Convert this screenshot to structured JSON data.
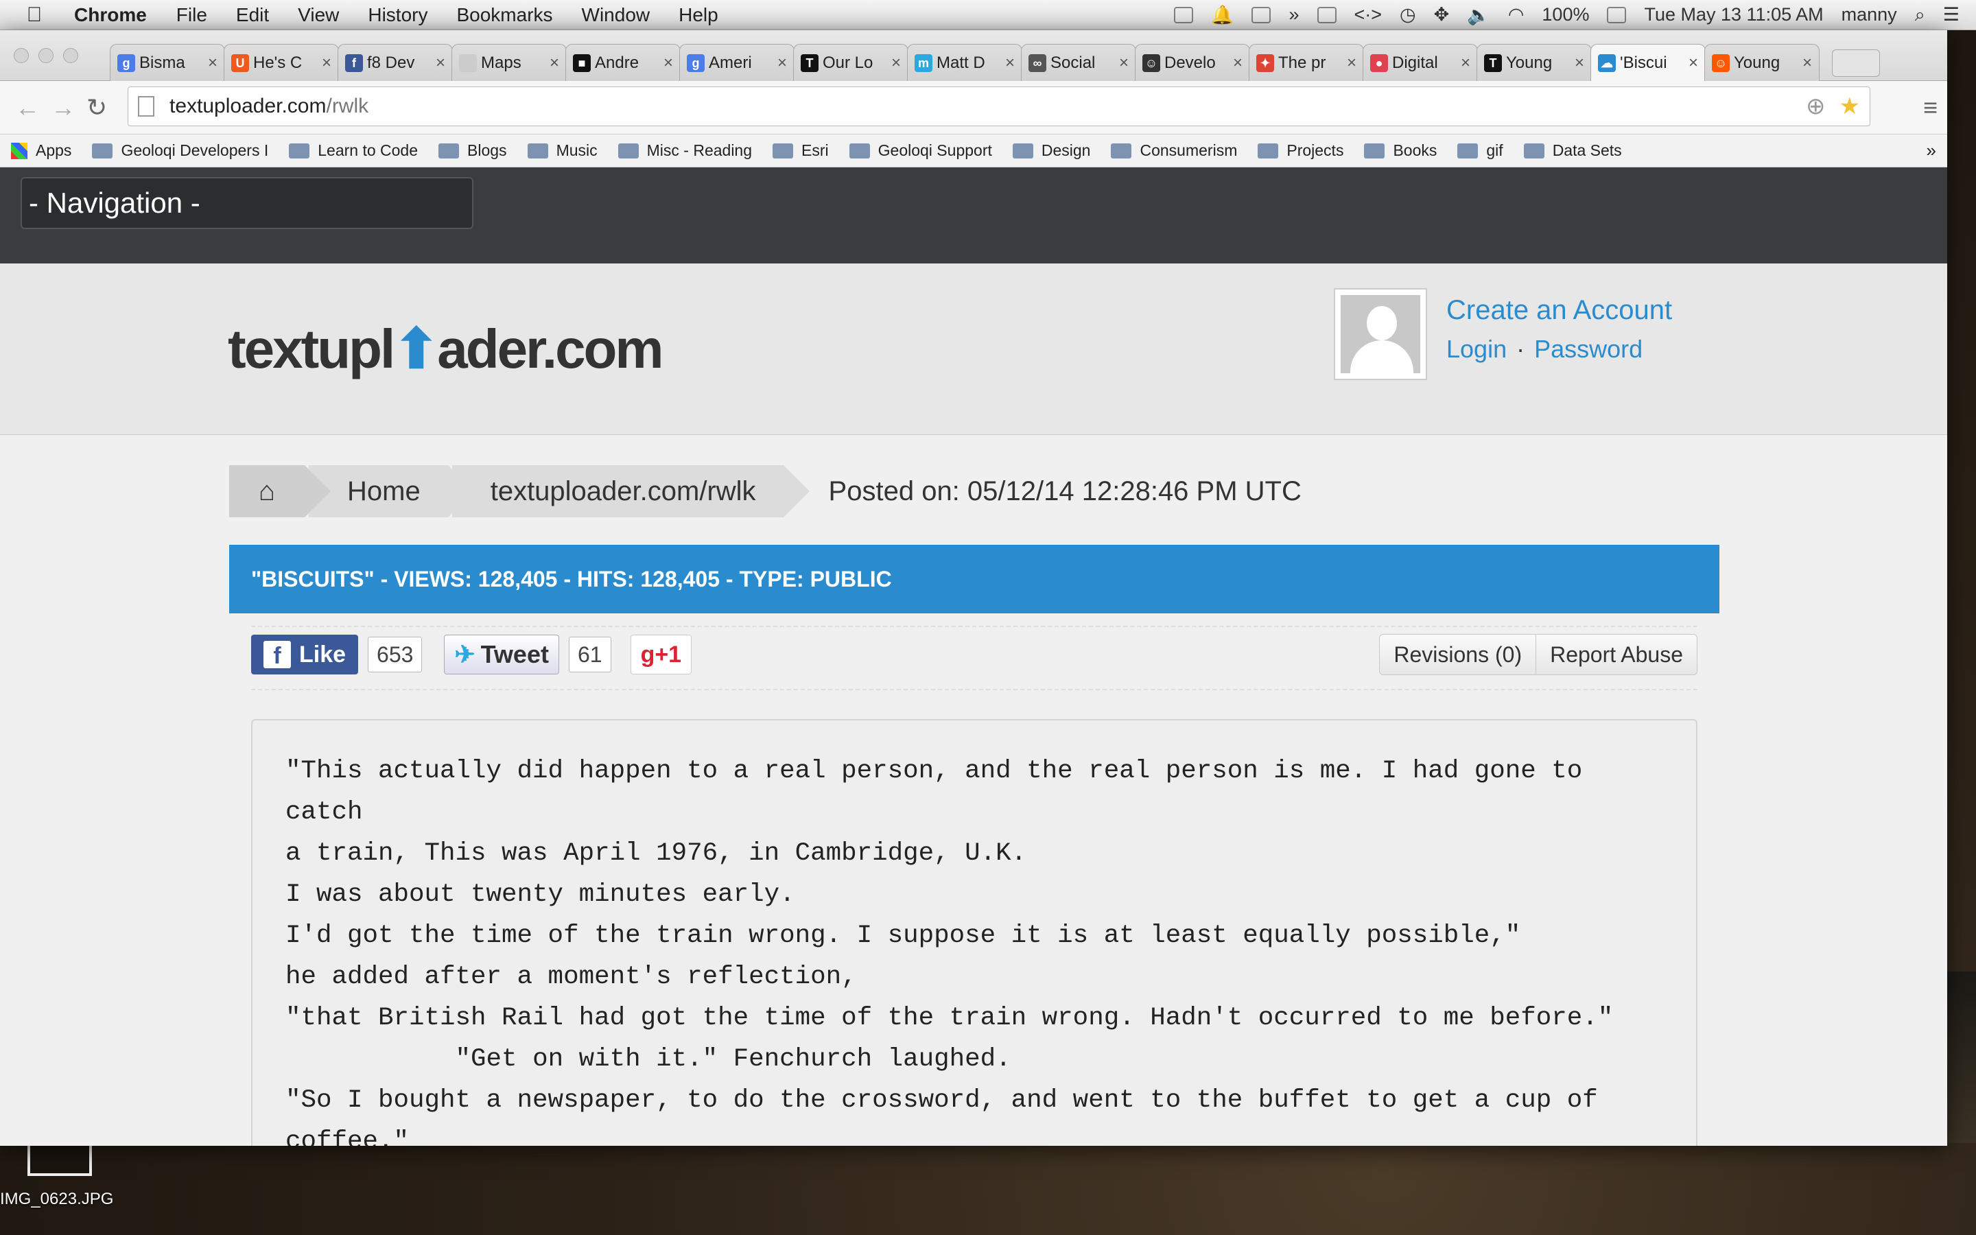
{
  "menubar": {
    "app": "Chrome",
    "items": [
      "File",
      "Edit",
      "View",
      "History",
      "Bookmarks",
      "Window",
      "Help"
    ],
    "battery": "100%",
    "datetime": "Tue May 13  11:05 AM",
    "user": "manny"
  },
  "tabs": [
    {
      "label": "Bisma",
      "color": "#4a7de8",
      "glyph": "g"
    },
    {
      "label": "He's C",
      "color": "#ee5a1d",
      "glyph": "U"
    },
    {
      "label": "f8 Dev",
      "color": "#3b5998",
      "glyph": "f"
    },
    {
      "label": "Maps",
      "color": "#cccccc",
      "glyph": ""
    },
    {
      "label": "Andre",
      "color": "#111111",
      "glyph": "■"
    },
    {
      "label": "Ameri",
      "color": "#4a7de8",
      "glyph": "g"
    },
    {
      "label": "Our Lo",
      "color": "#111111",
      "glyph": "T"
    },
    {
      "label": "Matt D",
      "color": "#2aa9e0",
      "glyph": "m"
    },
    {
      "label": "Social",
      "color": "#555555",
      "glyph": "∞"
    },
    {
      "label": "Develo",
      "color": "#333333",
      "glyph": "☺"
    },
    {
      "label": "The pr",
      "color": "#dd4433",
      "glyph": "✦"
    },
    {
      "label": "Digital",
      "color": "#e04050",
      "glyph": "●"
    },
    {
      "label": "Young",
      "color": "#111111",
      "glyph": "T"
    },
    {
      "label": "'Biscui",
      "color": "#2a8ccf",
      "glyph": "☁"
    },
    {
      "label": "Young",
      "color": "#ff5700",
      "glyph": "☺"
    }
  ],
  "address": {
    "host": "textuploader.com",
    "path": "/rwlk"
  },
  "bookmarks": [
    "Apps",
    "Geoloqi Developers I",
    "Learn to Code",
    "Blogs",
    "Music",
    "Misc - Reading",
    "Esri",
    "Geoloqi Support",
    "Design",
    "Consumerism",
    "Projects",
    "Books",
    "gif",
    "Data Sets"
  ],
  "site": {
    "nav_label": "- Navigation -",
    "logo_pre": "textupl",
    "logo_cloud": "⬆",
    "logo_post": "ader.com",
    "create_account": "Create an Account",
    "login": "Login",
    "dot": "·",
    "password": "Password"
  },
  "breadcrumb": {
    "home_icon": "⌂",
    "home": "Home",
    "current": "textuploader.com/rwlk",
    "posted": "Posted on: 05/12/14 12:28:46 PM UTC"
  },
  "post_header": "\"BISCUITS\" - VIEWS: 128,405 - HITS: 128,405 - TYPE: PUBLIC",
  "social": {
    "like_label": "Like",
    "like_count": "653",
    "tweet_label": "Tweet",
    "tweet_count": "61",
    "gplus_label": "g+1",
    "revisions": "Revisions (0)",
    "report": "Report Abuse"
  },
  "body_text": "\"This actually did happen to a real person, and the real person is me. I had gone to catch\na train, This was April 1976, in Cambridge, U.K.\nI was about twenty minutes early.\nI'd got the time of the train wrong. I suppose it is at least equally possible,\"\nhe added after a moment's reflection,\n\"that British Rail had got the time of the train wrong. Hadn't occurred to me before.\"\n           \"Get on with it.\" Fenchurch laughed.\n\"So I bought a newspaper, to do the crossword, and went to the buffet to get a cup of\ncoffee.\"\n       \"You do the crossword?\"",
  "desktop": {
    "icon_label": "IMG_0623.JPG"
  }
}
